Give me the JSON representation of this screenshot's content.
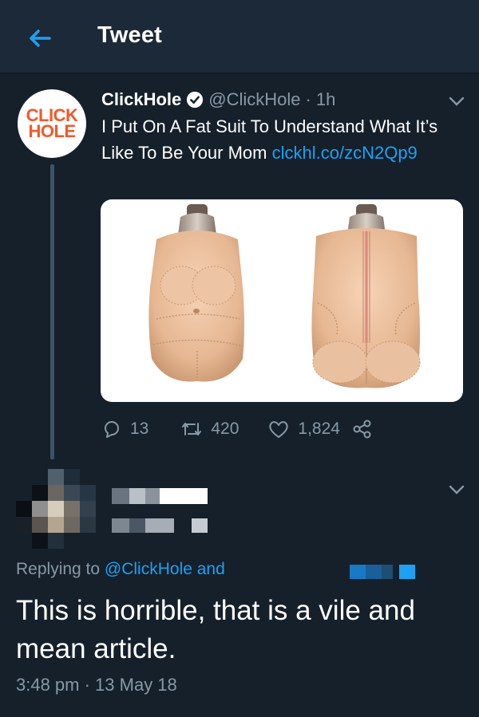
{
  "header": {
    "title": "Tweet",
    "back_icon": "back-arrow-icon",
    "accent": "#1da1f2"
  },
  "tweet": {
    "author": {
      "name": "ClickHole",
      "handle": "@ClickHole",
      "verified": true,
      "logo_line1": "CLICK",
      "logo_line2": "HOLE"
    },
    "time": "1h",
    "dot": "·",
    "text": "I Put On A Fat Suit To Understand What It’s Like To Be Your Mom ",
    "link": "clckhl.co/zcN2Qp9",
    "image_alt": "Front and back views of a padded fat suit on mannequins",
    "actions": {
      "replies": "13",
      "retweets": "420",
      "likes": "1,824"
    }
  },
  "reply": {
    "replying_prefix": "Replying to ",
    "replying_mention": "@ClickHole",
    "replying_suffix": " and",
    "text": "This is horrible, that is a vile and mean article.",
    "timestamp": "3:48 pm · 13 May 18"
  }
}
